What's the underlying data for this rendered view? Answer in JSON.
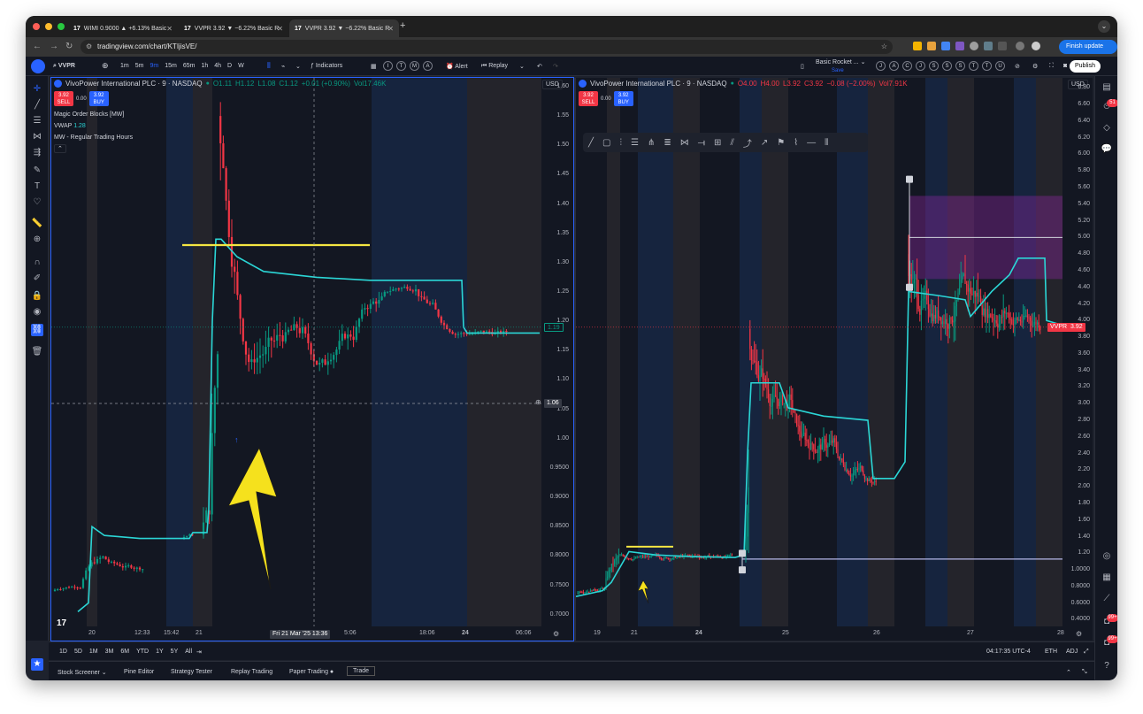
{
  "browser": {
    "tabs": [
      {
        "label": "WIMI 0.9000 ▲ +6.13% Basic"
      },
      {
        "label": "VVPR 3.92 ▼ −6.22% Basic R"
      },
      {
        "label": "VVPR 3.92 ▼ −6.22% Basic R"
      }
    ],
    "url": "tradingview.com/chart/KTIjisVE/",
    "finish_update": "Finish update"
  },
  "toolbar": {
    "symbol": "VVPR",
    "intervals": [
      "1m",
      "5m",
      "9m",
      "15m",
      "65m",
      "1h",
      "4h",
      "D",
      "W"
    ],
    "active_interval": "9m",
    "indicators": "Indicators",
    "alert": "Alert",
    "replay": "Replay",
    "layout_name": "Basic Rocket ...",
    "layout_sub": "Save",
    "publish": "Publish",
    "circle_letters": [
      "I",
      "T",
      "M",
      "A"
    ],
    "circle_letters_right": [
      "J",
      "A",
      "C",
      "J",
      "S",
      "S",
      "S",
      "T",
      "T",
      "U"
    ]
  },
  "left_chart": {
    "title": "VivoPower International PLC · 9 · NASDAQ",
    "ohlc": {
      "o": "O1.11",
      "h": "H1.12",
      "l": "L1.08",
      "c": "C1.12",
      "chg": "+0.01 (+0.90%)",
      "vol": "Vol17.46K"
    },
    "sell_price": "3.92",
    "sell_label": "SELL",
    "spread": "0.00",
    "buy_price": "3.92",
    "buy_label": "BUY",
    "indicators": [
      "Magic Order Blocks [MW]",
      "VWAP",
      "MW - Regular Trading Hours"
    ],
    "vwap_value": "1.28",
    "currency": "USD",
    "price_ticks": [
      "1.60",
      "1.55",
      "1.50",
      "1.45",
      "1.40",
      "1.35",
      "1.30",
      "1.25",
      "1.20",
      "1.15",
      "1.10",
      "1.05",
      "1.00",
      "0.9500",
      "0.9000",
      "0.8500",
      "0.8000",
      "0.7500",
      "0.7000"
    ],
    "last_price": "1.19",
    "cross_price": "1.06",
    "time_ticks": [
      "20",
      "12:33",
      "15:42",
      "21",
      "12:0",
      "18:06",
      "24",
      "06:06"
    ],
    "cross_time": "Fri 21 Mar '25   13:36",
    "cross_time_tail": "5:06",
    "arrow_marker": "↑"
  },
  "right_chart": {
    "title": "VivoPower International PLC · 9 · NASDAQ",
    "ohlc": {
      "o": "O4.00",
      "h": "H4.00",
      "l": "L3.92",
      "c": "C3.92",
      "chg": "−0.08 (−2.00%)",
      "vol": "Vol7.91K"
    },
    "sell_price": "3.92",
    "sell_label": "SELL",
    "spread": "0.00",
    "buy_price": "3.92",
    "buy_label": "BUY",
    "currency": "USD",
    "price_ticks": [
      "6.80",
      "6.60",
      "6.40",
      "6.20",
      "6.00",
      "5.80",
      "5.60",
      "5.40",
      "5.20",
      "5.00",
      "4.80",
      "4.60",
      "4.40",
      "4.20",
      "4.00",
      "3.80",
      "3.60",
      "3.40",
      "3.20",
      "3.00",
      "2.80",
      "2.60",
      "2.40",
      "2.20",
      "2.00",
      "1.80",
      "1.60",
      "1.40",
      "1.20",
      "1.0000",
      "0.8000",
      "0.6000",
      "0.4000"
    ],
    "last_price": "3.92",
    "symbol_tag": "VVPR",
    "time_ticks": [
      "19",
      "21",
      "24",
      "25",
      "26",
      "27",
      "28"
    ]
  },
  "bottom": {
    "ranges": [
      "1D",
      "5D",
      "1M",
      "3M",
      "6M",
      "YTD",
      "1Y",
      "5Y",
      "All"
    ],
    "time": "04:17:35 UTC-4",
    "session": "ETH",
    "adj": "ADJ",
    "panels": [
      "Stock Screener",
      "Pine Editor",
      "Strategy Tester",
      "Replay Trading",
      "Paper Trading",
      "Trade"
    ]
  },
  "colors": {
    "up": "#089981",
    "down": "#f23645",
    "vwap": "#2bd6d6",
    "level": "#f5e642",
    "accent": "#2962ff"
  }
}
